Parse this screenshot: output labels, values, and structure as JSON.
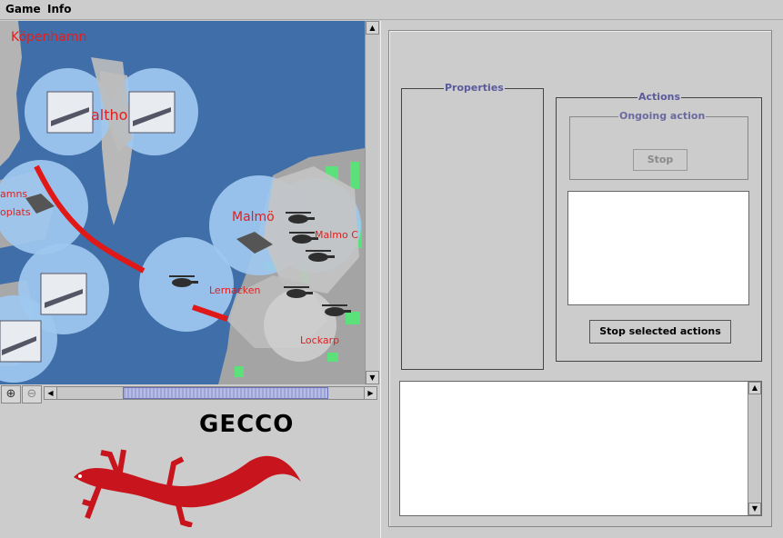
{
  "menu": {
    "game": "Game",
    "info": "Info"
  },
  "map": {
    "labels": [
      "Köpenhamn",
      "altho",
      "amns",
      "oplats",
      "Malmö",
      "Malmo C",
      "Lernacken",
      "Lockarp"
    ]
  },
  "zoom": {
    "zoom_in": "⊕",
    "zoom_out": "⊖"
  },
  "logo": {
    "text": "GECCO"
  },
  "properties": {
    "title": "Properties"
  },
  "actions": {
    "title": "Actions",
    "ongoing_title": "Ongoing action",
    "stop_label": "Stop",
    "stop_selected_label": "Stop selected actions"
  },
  "colors": {
    "water": "#3f6ea8",
    "land": "#b4b4b4",
    "unit_range": "#9ec8f0",
    "route": "#e01818",
    "gecko": "#c8141c"
  }
}
